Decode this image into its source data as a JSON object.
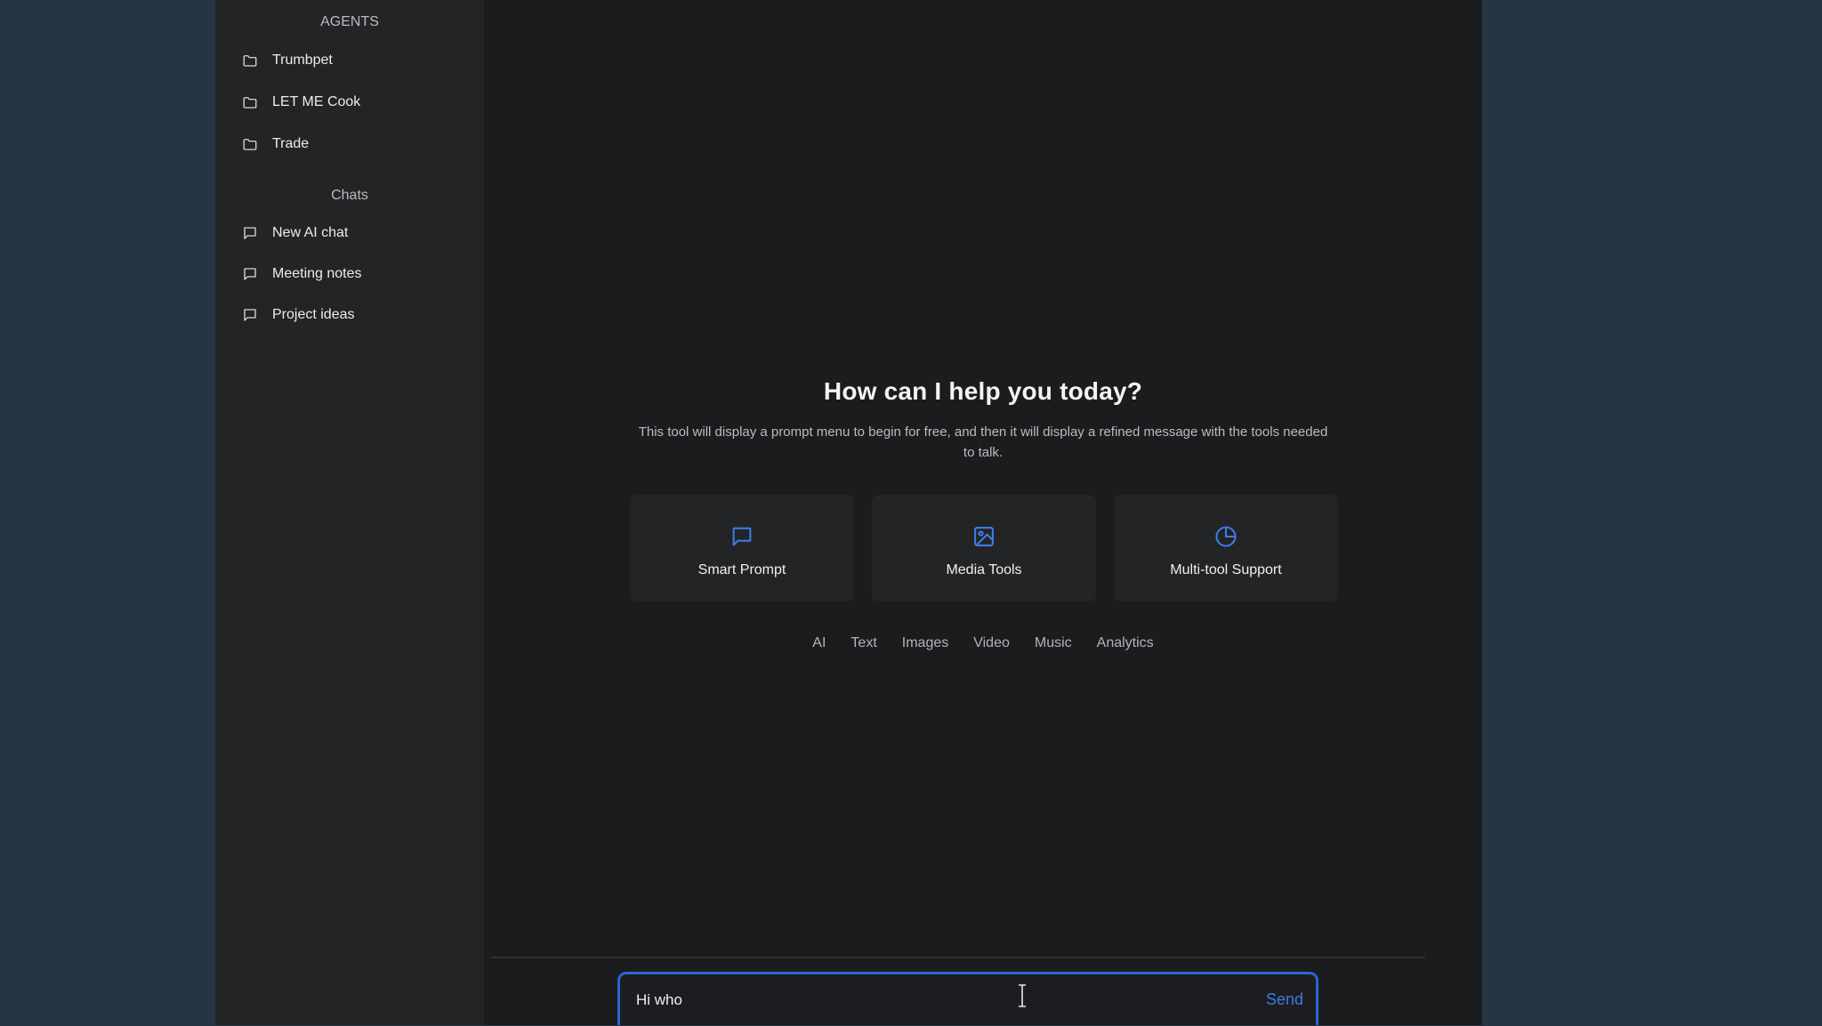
{
  "sidebar": {
    "agents_title": "AGENTS",
    "agents": [
      {
        "label": "Trumbpet",
        "icon": "folder-icon"
      },
      {
        "label": "LET ME Cook",
        "icon": "folder-icon"
      },
      {
        "label": "Trade",
        "icon": "folder-icon"
      }
    ],
    "chats_title": "Chats",
    "chats": [
      {
        "label": "New AI chat",
        "icon": "chat-bubble-icon"
      },
      {
        "label": "Meeting notes",
        "icon": "chat-bubble-icon"
      },
      {
        "label": "Project ideas",
        "icon": "chat-bubble-icon"
      }
    ]
  },
  "main": {
    "title": "How can I help you today?",
    "description": "This tool will display a prompt menu to begin for free, and then it will display a refined message with the tools needed to talk.",
    "cards": [
      {
        "label": "Smart Prompt",
        "icon": "chat-bubble-icon"
      },
      {
        "label": "Media Tools",
        "icon": "image-icon"
      },
      {
        "label": "Multi-tool Support",
        "icon": "pie-chart-icon"
      }
    ],
    "tags": [
      "AI",
      "Text",
      "Images",
      "Video",
      "Music",
      "Analytics"
    ]
  },
  "composer": {
    "value": "Hi who",
    "send_label": "Send"
  },
  "colors": {
    "accent": "#2f63d2",
    "icon_blue": "#3f7ae3",
    "background": "#263543",
    "sidebar": "#232425",
    "main": "#1b1c1e"
  }
}
